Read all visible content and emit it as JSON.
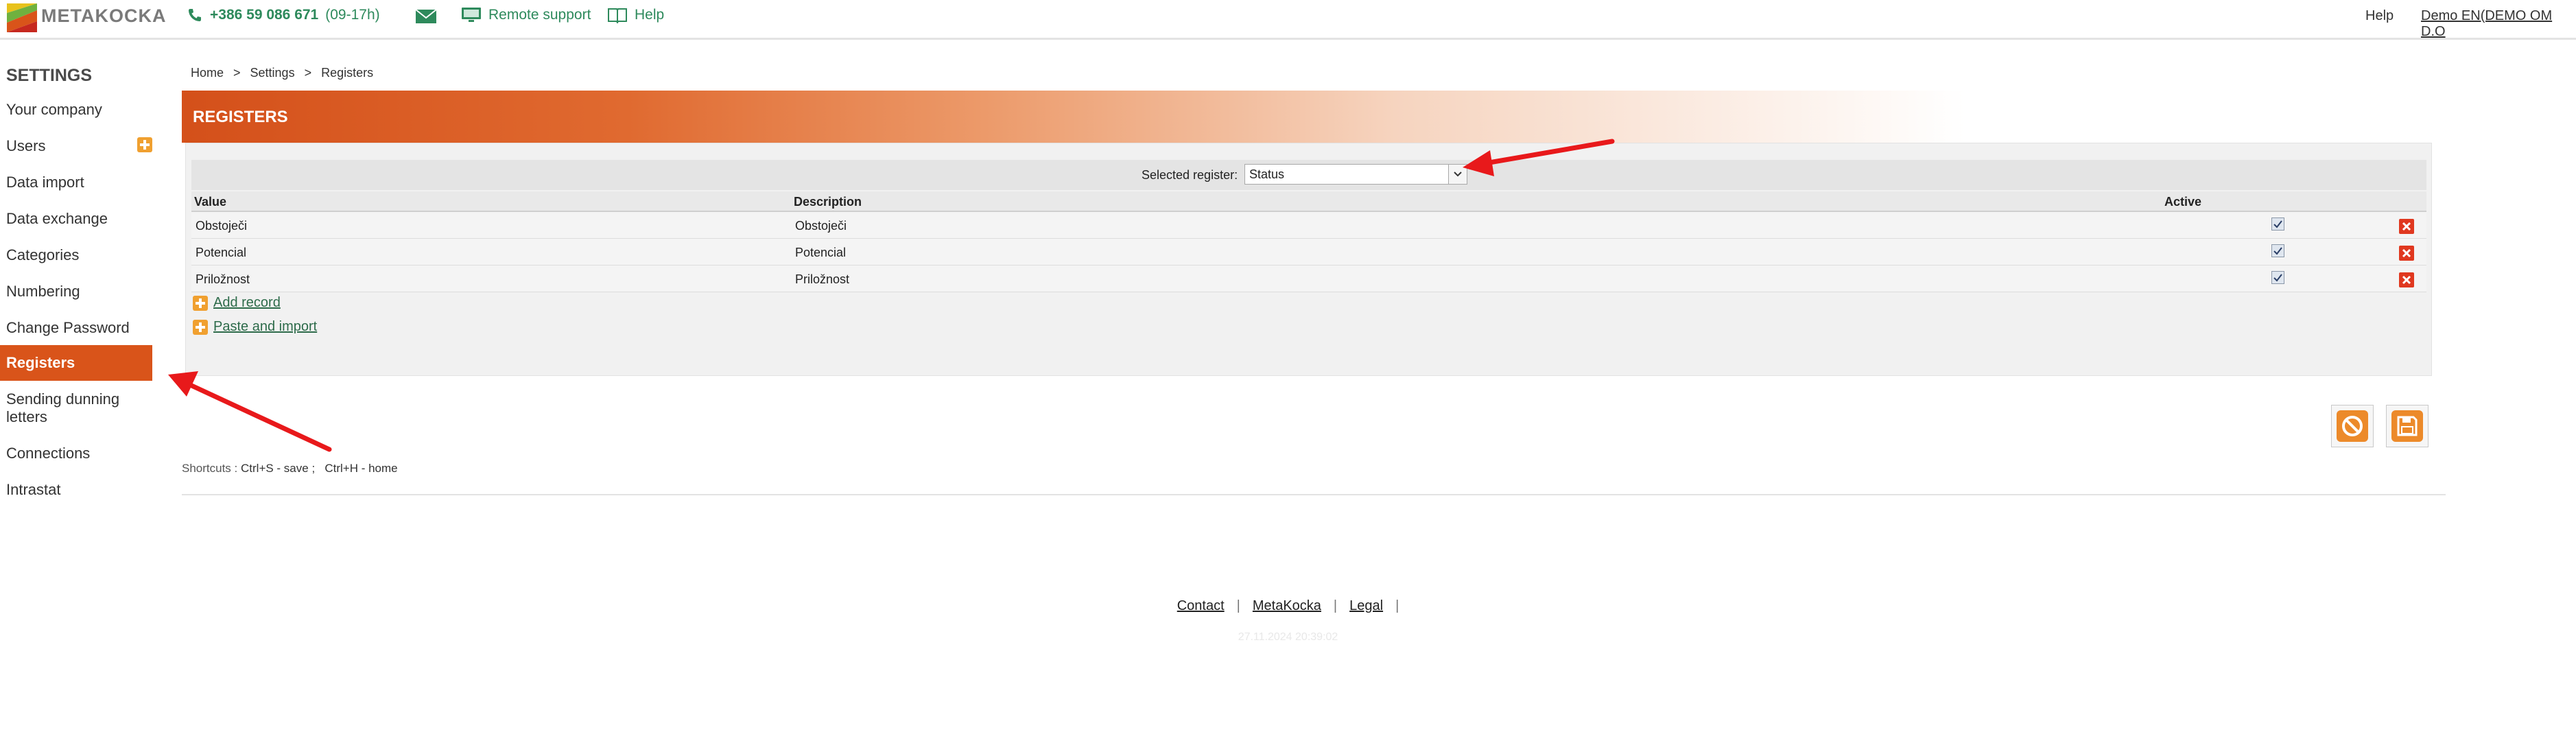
{
  "header": {
    "logo_text": "METAKOCKA",
    "phone_number": "+386 59 086 671",
    "phone_hours": "(09-17h)",
    "remote_support": "Remote support",
    "help": "Help",
    "help_right": "Help",
    "user": "Demo EN(DEMO OM D.O"
  },
  "sidebar": {
    "title": "SETTINGS",
    "items": [
      {
        "label": "Your company"
      },
      {
        "label": "Users"
      },
      {
        "label": "Data import"
      },
      {
        "label": "Data exchange"
      },
      {
        "label": "Categories"
      },
      {
        "label": "Numbering"
      },
      {
        "label": "Change Password"
      },
      {
        "label": "Registers"
      },
      {
        "label": "Sending dunning letters"
      },
      {
        "label": "Connections"
      },
      {
        "label": "Intrastat"
      }
    ]
  },
  "breadcrumb": [
    "Home",
    ">",
    "Settings",
    ">",
    "Registers"
  ],
  "page_title": "REGISTERS",
  "selector": {
    "label": "Selected register:",
    "value": "Status"
  },
  "table": {
    "columns": [
      "Value",
      "Description",
      "Active"
    ],
    "rows": [
      {
        "value": "Obstoječi",
        "description": "Obstoječi",
        "active": true
      },
      {
        "value": "Potencial",
        "description": "Potencial",
        "active": true
      },
      {
        "value": "Priložnost",
        "description": "Priložnost",
        "active": true
      }
    ]
  },
  "actions": {
    "add_record": "Add record",
    "paste_import": "Paste and import"
  },
  "shortcuts": {
    "label": "Shortcuts :",
    "save": "Ctrl+S - save ;",
    "home": "Ctrl+H - home"
  },
  "footer": {
    "links": [
      "Contact",
      "MetaKocka",
      "Legal"
    ],
    "timestamp": "27.11.2024 20:39:02"
  },
  "colors": {
    "accent": "#d9541a",
    "link_green": "#2e8a5c",
    "delete_red": "#e0381f"
  }
}
